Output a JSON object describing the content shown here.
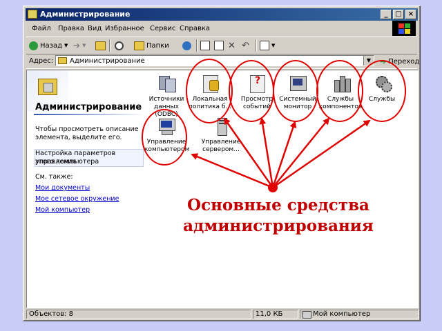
{
  "window": {
    "title": "Администрирование"
  },
  "title_buttons": {
    "minimize": "_",
    "maximize": "□",
    "close": "×"
  },
  "menu": [
    "Файл",
    "Правка",
    "Вид",
    "Избранное",
    "Сервис",
    "Справка"
  ],
  "toolbar": {
    "back": "Назад",
    "folders": "Папки"
  },
  "address": {
    "label": "Адрес:",
    "value": "Администрирование",
    "go": "Переход"
  },
  "left_pane": {
    "title": "Администрирование",
    "hint": [
      "Чтобы просмотреть описание",
      "элемента, выделите его."
    ],
    "selected_desc": [
      "Настройка параметров управления",
      "этого компьютера"
    ],
    "see_also": "См. также:",
    "links": [
      "Мои документы",
      "Мое сетевое окружение",
      "Мой компьютер"
    ]
  },
  "icons": [
    {
      "label": [
        "Источники",
        "данных",
        "(ODBC)"
      ]
    },
    {
      "label": [
        "Локальная",
        "политика б..."
      ]
    },
    {
      "label": [
        "Просмотр",
        "событий"
      ]
    },
    {
      "label": [
        "Системный",
        "монитор"
      ]
    },
    {
      "label": [
        "Службы",
        "компонентов"
      ]
    },
    {
      "label": [
        "Службы"
      ]
    },
    {
      "label": [
        "Управление",
        "компьютером"
      ]
    },
    {
      "label": [
        "Управление",
        "сервером..."
      ]
    }
  ],
  "status": {
    "objects": "Объектов: 8",
    "size": "11,0 КБ",
    "location": "Мой компьютер"
  },
  "caption": [
    "Основные средства",
    "администрирования"
  ],
  "colors": {
    "background": "#c8ccf6",
    "annotation_red": "#e00000",
    "title_bar": "#0a246a"
  }
}
